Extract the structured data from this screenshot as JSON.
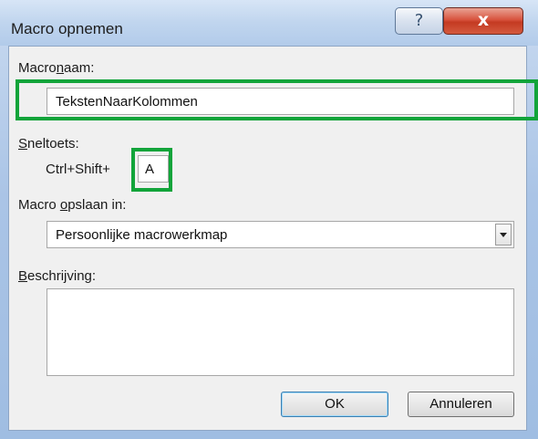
{
  "window": {
    "title": "Macro opnemen",
    "help_glyph": "?",
    "close_glyph": "x"
  },
  "form": {
    "macro_name_label_pre": "Macro",
    "macro_name_label_ul": "n",
    "macro_name_label_post": "aam:",
    "macro_name_value": "TekstenNaarKolommen",
    "shortcut_label_ul": "S",
    "shortcut_label_post": "neltoets:",
    "shortcut_prefix": "Ctrl+Shift+",
    "shortcut_value": "A",
    "store_label_pre": "Macro ",
    "store_label_ul": "o",
    "store_label_post": "pslaan in:",
    "store_value": "Persoonlijke macrowerkmap",
    "description_label_ul": "B",
    "description_label_post": "eschrijving:",
    "description_value": ""
  },
  "buttons": {
    "ok": "OK",
    "cancel": "Annuleren"
  },
  "colors": {
    "highlight": "#12a43a",
    "close_button": "#c43a22"
  },
  "icons": [
    "help-icon",
    "close-icon",
    "dropdown-arrow-icon"
  ]
}
